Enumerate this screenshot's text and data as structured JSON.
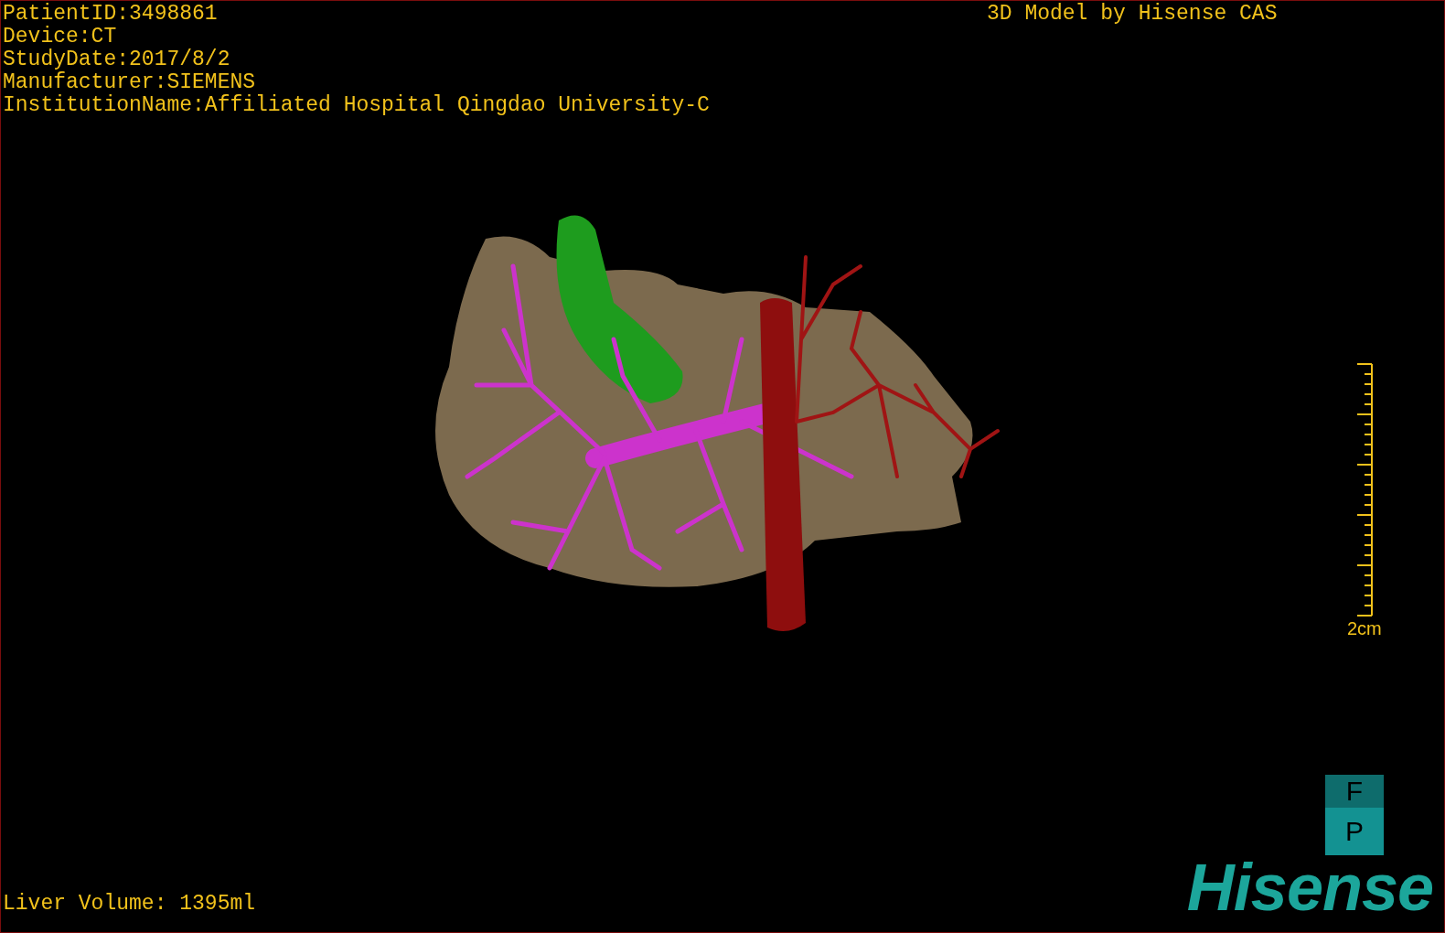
{
  "patient_info": [
    "PatientID:3498861",
    "Device:CT",
    "StudyDate:2017/8/2",
    "Manufacturer:SIEMENS",
    "InstitutionName:Affiliated Hospital Qingdao University-C"
  ],
  "title": "3D Model by Hisense CAS",
  "scale_bar": {
    "label": "2cm"
  },
  "orientation_marker": {
    "top": "F",
    "bottom": "P"
  },
  "liver_volume": "Liver Volume: 1395ml",
  "logo": "Hisense"
}
